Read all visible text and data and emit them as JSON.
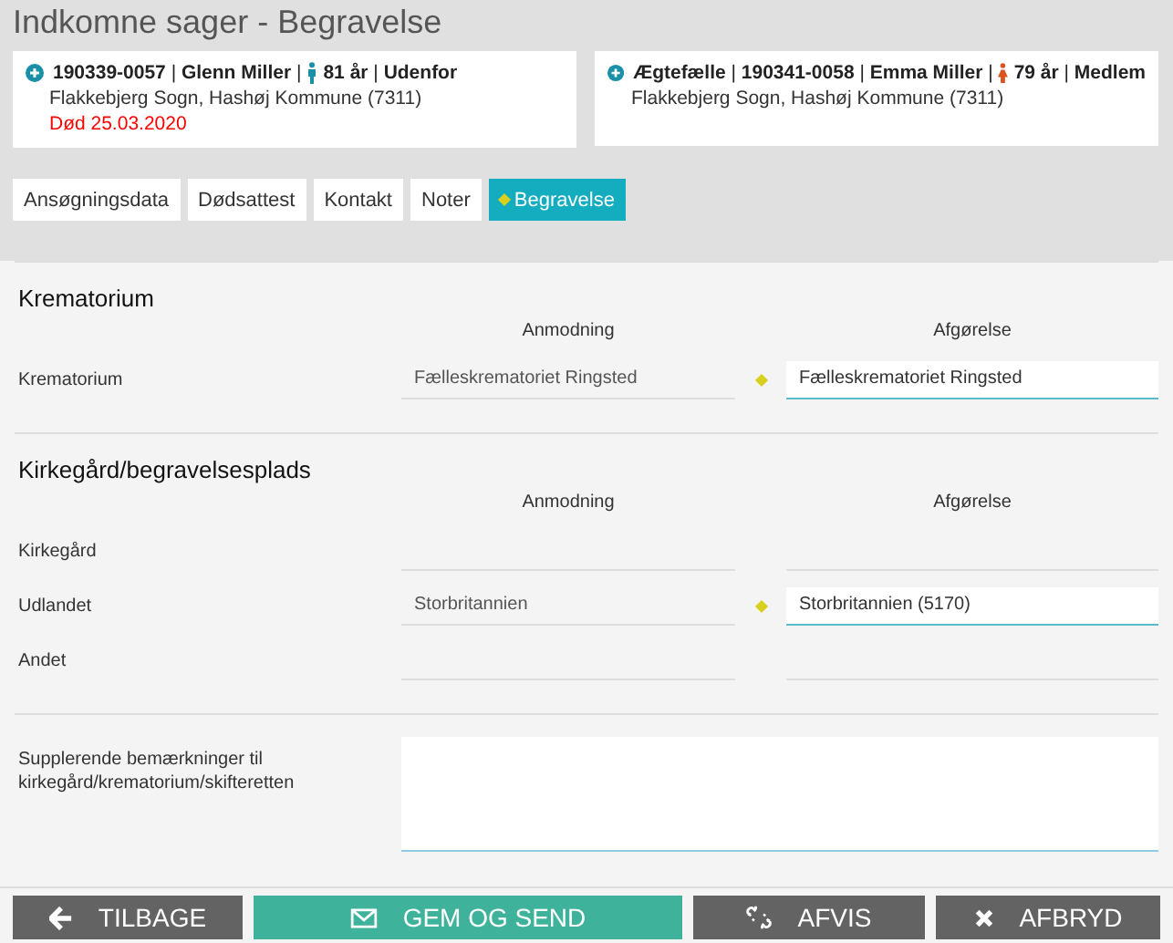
{
  "page_title": "Indkomne sager - Begravelse",
  "persons": [
    {
      "heading": "**190339-0057** | **Glenn Miller** |",
      "kind": "male",
      "details": "**81 år** | **Udenfor**",
      "address": "Flakkebjerg Sogn, Hashøj Kommune (7311)",
      "death": "Død 25.03.2020"
    },
    {
      "heading": "**Ægtefælle** | **190341-0058** | **Emma Miller** |",
      "kind": "female",
      "details": "**79 år** | **Medlem**",
      "address": "Flakkebjerg Sogn, Hashøj Kommune (7311)"
    }
  ],
  "tabs": [
    {
      "label": "Ansøgningsdata",
      "selected": false
    },
    {
      "label": "Dødsattest",
      "selected": false
    },
    {
      "label": "Kontakt",
      "selected": false
    },
    {
      "label": "Noter",
      "selected": false
    },
    {
      "label": "Begravelse",
      "selected": true
    }
  ],
  "sections": [
    {
      "title": "Krematorium",
      "request_header": "Anmodning",
      "decision_header": "Afgørelse",
      "rows": [
        {
          "label": "Krematorium",
          "request": "Fælleskrematoriet Ringsted",
          "decision": "Fælleskrematoriet Ringsted",
          "changed": true
        }
      ]
    },
    {
      "title": "Kirkegård/begravelsesplads",
      "request_header": "Anmodning",
      "decision_header": "Afgørelse",
      "rows": [
        {
          "label": "Kirkegård",
          "changed": false
        },
        {
          "label": "Udlandet",
          "request": "Storbritannien",
          "decision": "Storbritannien (5170)",
          "changed": true
        },
        {
          "label": "Andet",
          "changed": false
        }
      ]
    }
  ],
  "remarks": {
    "label": "Supplerende bemærkninger til kirkegård/krematorium/skifteretten"
  },
  "buttons": [
    {
      "kind": "back",
      "label": "TILBAGE"
    },
    {
      "kind": "send",
      "label": "GEM OG SEND"
    },
    {
      "kind": "reject",
      "label": "AFVIS"
    },
    {
      "kind": "cancel",
      "label": "AFBRYD"
    }
  ]
}
